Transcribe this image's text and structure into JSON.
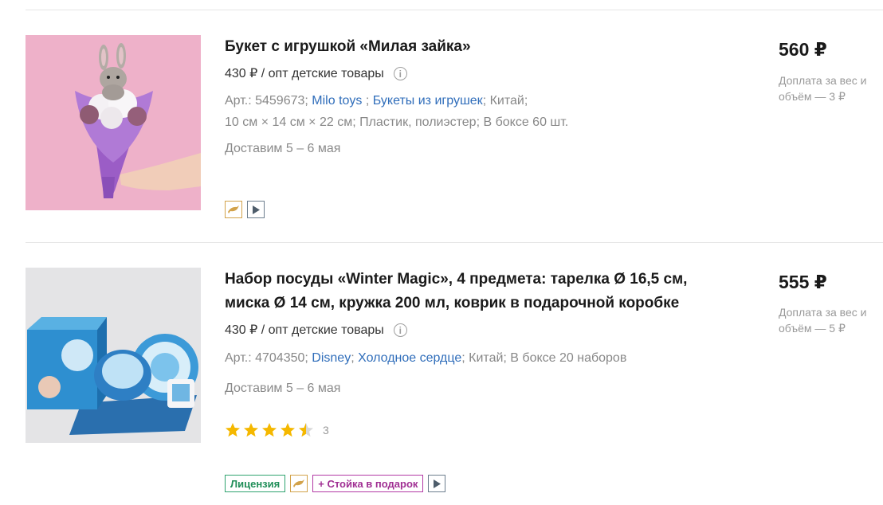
{
  "products": [
    {
      "title": "Букет с игрушкой «Милая зайка»",
      "wholesale": "430 ₽ / опт детские товары",
      "info_icon": "i",
      "article": "Арт.: 5459673;",
      "brand": "Milo toys",
      "category": "Букеты из игрушек",
      "country": "Китай;",
      "specs": "10 см × 14 см × 22 см; Пластик, полиэстер; В боксе 60 шт.",
      "delivery": "Доставим 5 – 6 мая",
      "price": "560 ₽",
      "surcharge": "Доплата за вес и объём — 3 ₽",
      "badges": [
        "dolphin-icon",
        "play-icon"
      ]
    },
    {
      "title": "Набор посуды «Winter Magic», 4 предмета: тарелка Ø 16,5 см, миска Ø 14 см, кружка 200 мл, коврик в подарочной коробке",
      "wholesale": "430 ₽ / опт детские товары",
      "info_icon": "i",
      "article": "Арт.: 4704350;",
      "brand": "Disney",
      "category": "Холодное сердце",
      "country": "Китай; В боксе 20 наборов",
      "delivery": "Доставим 5 – 6 мая",
      "rating": 4.5,
      "rating_count": "3",
      "price": "555 ₽",
      "surcharge": "Доплата за вес и объём — 5 ₽",
      "badge_license": "Лицензия",
      "badge_stand": "+ Стойка в подарок",
      "badges": [
        "dolphin-icon",
        "play-icon"
      ]
    }
  ],
  "colors": {
    "link": "#2f6dba",
    "star": "#f5b800",
    "license": "#1f8e58",
    "stand": "#a02f93",
    "dolphin": "#d2a24a"
  }
}
